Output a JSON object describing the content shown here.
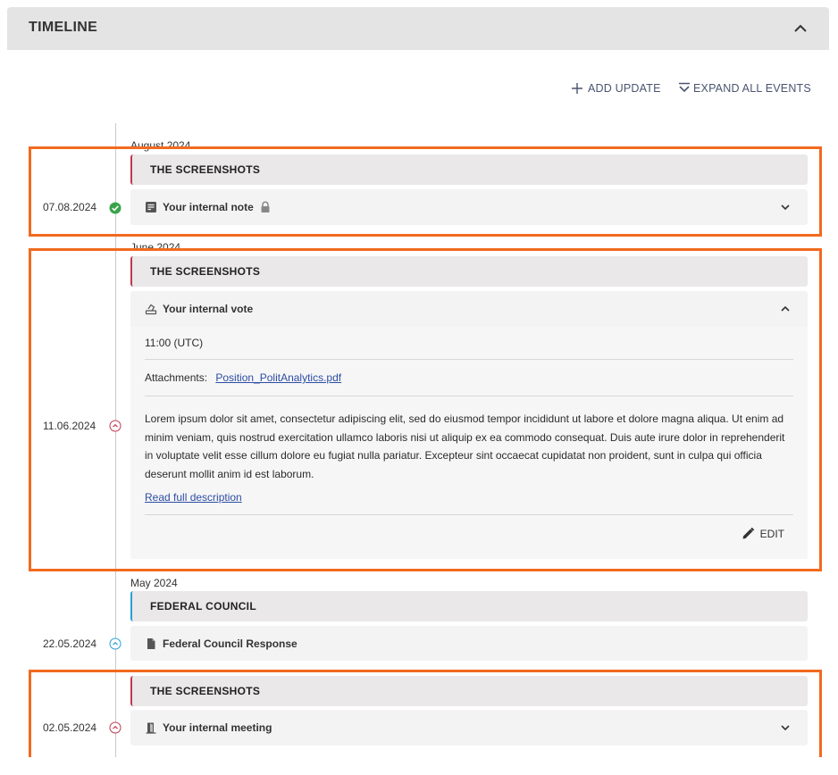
{
  "panel": {
    "title": "TIMELINE"
  },
  "actions": {
    "add_update": "ADD UPDATE",
    "expand_all": "EXPAND ALL EVENTS"
  },
  "groups": [
    {
      "month": "August 2024",
      "date": "07.08.2024",
      "status": "done",
      "source": "THE SCREENSHOTS",
      "event": {
        "title": "Your internal note",
        "icon": "note-icon",
        "locked": true,
        "expanded": false
      }
    },
    {
      "month": "June 2024",
      "date": "11.06.2024",
      "status": "pending",
      "source": "THE SCREENSHOTS",
      "event": {
        "title": "Your internal vote",
        "icon": "ballot-icon",
        "expanded": true,
        "time": "11:00 (UTC)",
        "attachments_label": "Attachments:",
        "attachment": "Position_PolitAnalytics.pdf",
        "description": "Lorem ipsum dolor sit amet, consectetur adipiscing elit, sed do eiusmod tempor incididunt ut labore et dolore magna aliqua. Ut enim ad minim veniam, quis nostrud exercitation ullamco laboris nisi ut aliquip ex ea commodo consequat. Duis aute irure dolor in reprehenderit in voluptate velit esse cillum dolore eu fugiat nulla pariatur. Excepteur sint occaecat cupidatat non proident, sunt in culpa qui officia deserunt mollit anim id est laborum.",
        "read_more": "Read full description",
        "edit": "EDIT"
      }
    },
    {
      "month": "May 2024",
      "date": "22.05.2024",
      "status": "info",
      "source": "FEDERAL COUNCIL",
      "event": {
        "title": "Federal Council Response",
        "icon": "document-icon"
      }
    },
    {
      "month": "",
      "date": "02.05.2024",
      "status": "pending",
      "source": "THE SCREENSHOTS",
      "event": {
        "title": "Your internal meeting",
        "icon": "door-icon",
        "expanded": false
      }
    }
  ],
  "colors": {
    "accent_red": "#c0394f",
    "accent_blue": "#2a9fd6",
    "status_green": "#3aa34a",
    "highlight": "#f26a1f",
    "link": "#2c4da3"
  }
}
